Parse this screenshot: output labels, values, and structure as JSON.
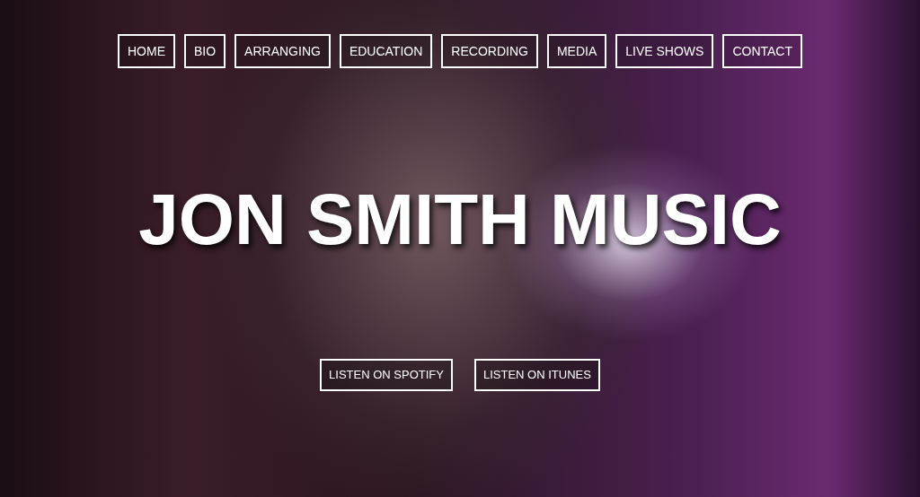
{
  "nav": {
    "items": [
      {
        "label": "HOME"
      },
      {
        "label": "BIO"
      },
      {
        "label": "ARRANGING"
      },
      {
        "label": "EDUCATION"
      },
      {
        "label": "RECORDING"
      },
      {
        "label": "MEDIA"
      },
      {
        "label": "LIVE SHOWS"
      },
      {
        "label": "CONTACT"
      }
    ]
  },
  "hero": {
    "title": "JON SMITH MUSIC",
    "buttons": [
      {
        "label": "LISTEN ON SPOTIFY"
      },
      {
        "label": "LISTEN ON ITUNES"
      }
    ]
  }
}
